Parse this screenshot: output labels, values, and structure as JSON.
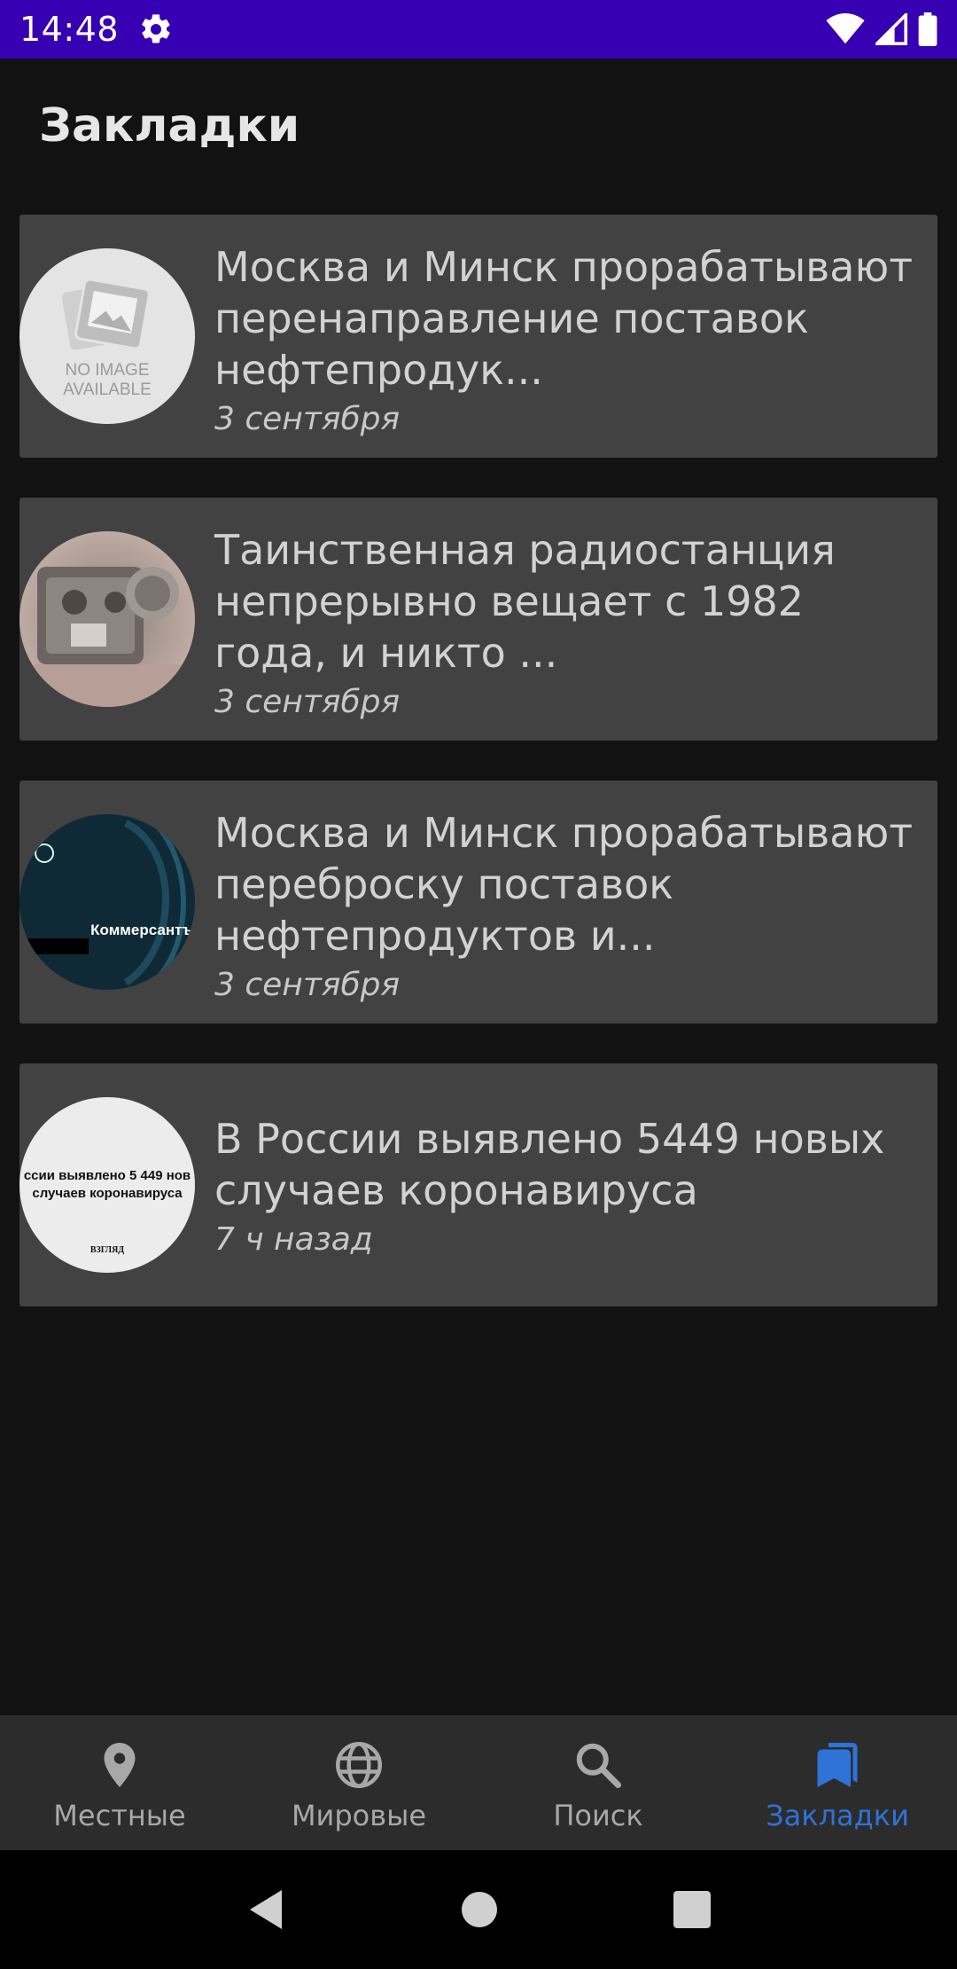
{
  "status_bar": {
    "time": "14:48",
    "icons": [
      "gear-icon",
      "wifi-icon",
      "signal-icon",
      "battery-icon"
    ],
    "background": "#3700b3"
  },
  "header": {
    "title": "Закладки"
  },
  "bookmarks": [
    {
      "title": "Москва и Минск прорабатывают перенаправление поставок нефтепродук...",
      "date": "3 сентября",
      "thumb": {
        "kind": "placeholder",
        "line1": "NO IMAGE",
        "line2": "AVAILABLE"
      }
    },
    {
      "title": "Таинственная радиостанция непрерывно вещает с 1982 года, и никто ...",
      "date": "3 сентября",
      "thumb": {
        "kind": "photo",
        "subject": "radio"
      }
    },
    {
      "title": "Москва и Минск прорабатывают переброску поставок нефтепродуктов и...",
      "date": "3 сентября",
      "thumb": {
        "kind": "logo",
        "logo_text": "Коммерсантъ"
      }
    },
    {
      "title": "В России выявлено 5449 новых случаев коронавируса",
      "date": "7 ч назад",
      "thumb": {
        "kind": "text",
        "line1": "ссии выявлено 5 449 нов",
        "line2": "случаев коронавируса",
        "logo_text": "ВЗГЛЯД"
      }
    }
  ],
  "bottom_nav": {
    "items": [
      {
        "label": "Местные",
        "icon": "location-pin-icon",
        "active": false
      },
      {
        "label": "Мировые",
        "icon": "globe-icon",
        "active": false
      },
      {
        "label": "Поиск",
        "icon": "search-icon",
        "active": false
      },
      {
        "label": "Закладки",
        "icon": "bookmarks-icon",
        "active": true
      }
    ],
    "active_color": "#2f72d8"
  },
  "system_nav": {
    "buttons": [
      "back-icon",
      "home-icon",
      "recents-icon"
    ]
  }
}
